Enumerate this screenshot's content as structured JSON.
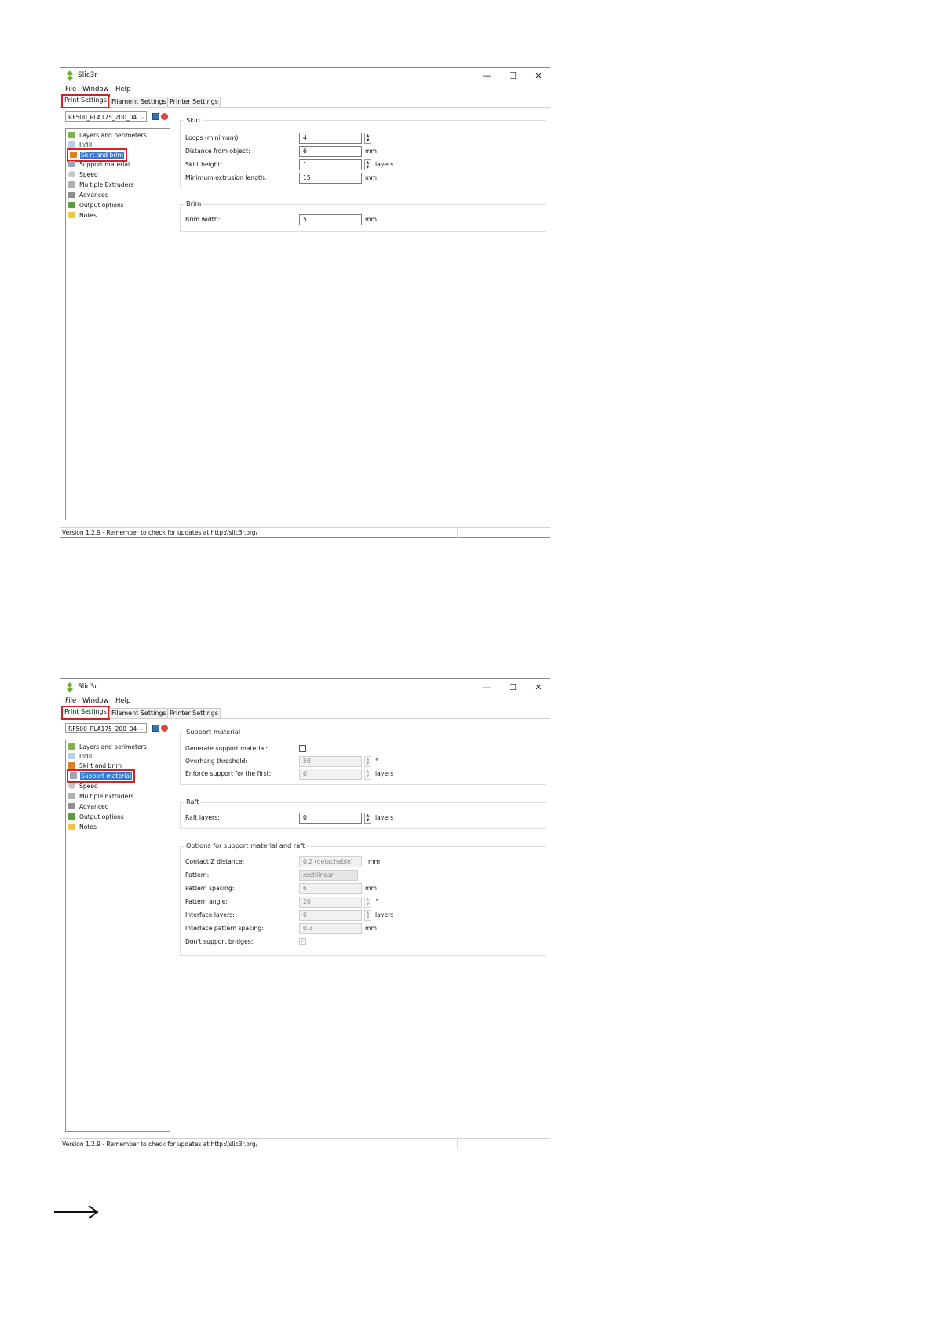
{
  "window": {
    "title": "Slic3r",
    "minimize": "—",
    "maximize": "☐",
    "close": "✕"
  },
  "menu": [
    "File",
    "Window",
    "Help"
  ],
  "tabs": [
    "Print Settings",
    "Filament Settings",
    "Printer Settings"
  ],
  "preset": {
    "value": "RF500_PLA175_200_04",
    "dropdown": "⌵"
  },
  "tree": [
    "Layers and perimeters",
    "Infill",
    "Skirt and brim",
    "Support material",
    "Speed",
    "Multiple Extruders",
    "Advanced",
    "Output options",
    "Notes"
  ],
  "status": "Version 1.2.9 - Remember to check for updates at http://slic3r.org/",
  "panel1": {
    "skirt": {
      "title": "Skirt",
      "loops_label": "Loops (minimum):",
      "loops_value": "4",
      "distance_label": "Distance from object:",
      "distance_value": "6",
      "distance_unit": "mm",
      "height_label": "Skirt height:",
      "height_value": "1",
      "height_unit": "layers",
      "min_extrusion_label": "Minimum extrusion length:",
      "min_extrusion_value": "15",
      "min_extrusion_unit": "mm"
    },
    "brim": {
      "title": "Brim",
      "width_label": "Brim width:",
      "width_value": "5",
      "width_unit": "mm"
    }
  },
  "panel2": {
    "support": {
      "title": "Support material",
      "generate_label": "Generate support material:",
      "overhang_label": "Overhang threshold:",
      "overhang_value": "50",
      "overhang_unit": "°",
      "enforce_label": "Enforce support for the first:",
      "enforce_value": "0",
      "enforce_unit": "layers"
    },
    "raft": {
      "title": "Raft",
      "layers_label": "Raft layers:",
      "layers_value": "0",
      "layers_unit": "layers"
    },
    "options": {
      "title": "Options for support material and raft",
      "contact_label": "Contact Z distance:",
      "contact_value": "0.2 (detachable)",
      "contact_unit": "mm",
      "pattern_label": "Pattern:",
      "pattern_value": "rectilinear",
      "spacing_label": "Pattern spacing:",
      "spacing_value": "6",
      "spacing_unit": "mm",
      "angle_label": "Pattern angle:",
      "angle_value": "20",
      "angle_unit": "°",
      "interface_label": "Interface layers:",
      "interface_value": "0",
      "interface_unit": "layers",
      "interface_spacing_label": "Interface pattern spacing:",
      "interface_spacing_value": "0.3",
      "interface_spacing_unit": "mm",
      "bridges_label": "Don't support bridges:",
      "bridges_check": "✓"
    }
  }
}
